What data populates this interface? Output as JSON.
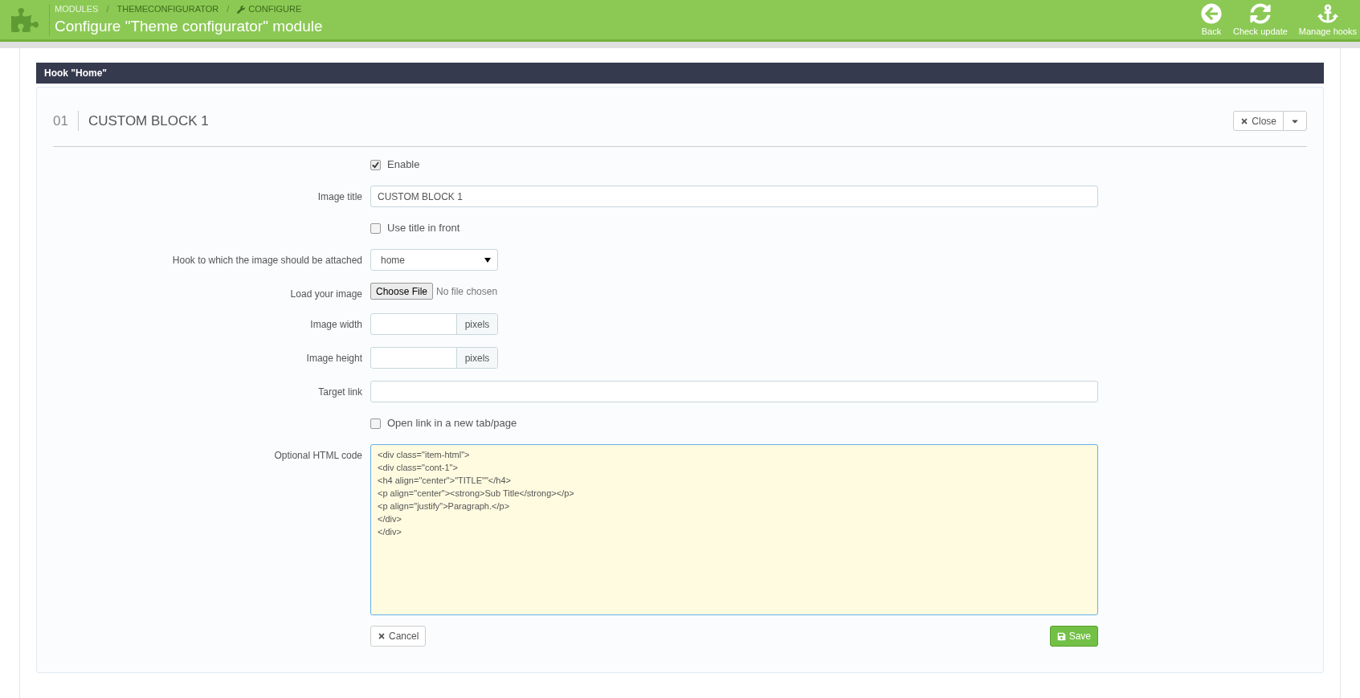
{
  "header": {
    "breadcrumbs": [
      "MODULES",
      "THEMECONFIGURATOR",
      "CONFIGURE"
    ],
    "separator": "/",
    "title": "Configure \"Theme configurator\" module",
    "actions": [
      {
        "kind": "back",
        "label": "Back"
      },
      {
        "kind": "refresh",
        "label": "Check update"
      },
      {
        "kind": "anchor",
        "label": "Manage hooks"
      }
    ]
  },
  "hook_bar": {
    "title": "Hook \"Home\""
  },
  "block": {
    "number": "01",
    "title": "CUSTOM BLOCK 1",
    "close_button": "Close",
    "rows": [
      {
        "kind": "checkbox",
        "label": "Enable",
        "checked": true
      },
      {
        "kind": "text",
        "label": "Image title",
        "value": "CUSTOM BLOCK 1"
      },
      {
        "kind": "checkbox",
        "label": "Use title in front",
        "checked": false
      },
      {
        "kind": "select",
        "label": "Hook to which the image should be attached",
        "value": "home"
      },
      {
        "kind": "file",
        "label": "Load your image",
        "button": "Choose File",
        "status": "No file chosen"
      },
      {
        "kind": "addon",
        "label": "Image width",
        "addon": "pixels"
      },
      {
        "kind": "addon",
        "label": "Image height",
        "addon": "pixels"
      },
      {
        "kind": "text",
        "label": "Target link"
      },
      {
        "kind": "checkbox",
        "label": "Open link in a new tab/page",
        "checked": false
      },
      {
        "kind": "textarea",
        "label": "Optional HTML code",
        "lines": [
          "<div class=\"item-html\">",
          "<div class=\"cont-1\">",
          "<h4 align=\"center\">\"TITLE\"\"</h4>",
          "<p align=\"center\"><strong>Sub Title</strong></p>",
          "<p align=\"justify\">Paragraph.</p>",
          "</div>",
          "</div>"
        ]
      }
    ],
    "cancel_button": "Cancel",
    "save_button": "Save"
  }
}
